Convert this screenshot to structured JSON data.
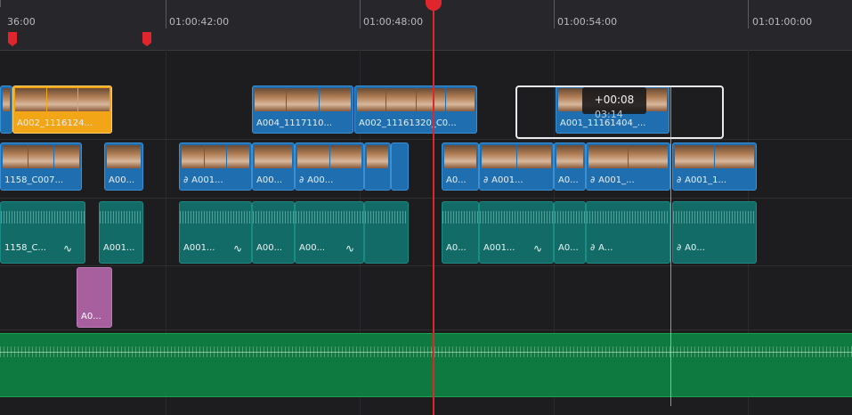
{
  "ruler": {
    "timecodes": [
      "36:00",
      "01:00:42:00",
      "01:00:48:00",
      "01:00:54:00",
      "01:01:00:00"
    ]
  },
  "tooltip": {
    "delta": "+00:08",
    "frames": "03:14"
  },
  "tracks": {
    "v2": [
      {
        "label": "A002_1116124..."
      },
      {
        "label": "A004_1117110..."
      },
      {
        "label": "A002_11161320_C0..."
      },
      {
        "label": "A001_11161404_..."
      }
    ],
    "v1": [
      {
        "label": "1158_C007..."
      },
      {
        "label": "A00..."
      },
      {
        "label": "A001..."
      },
      {
        "label": "A00..."
      },
      {
        "label": "A00..."
      },
      {
        "label": "A0..."
      },
      {
        "label": "A001..."
      },
      {
        "label": "A0..."
      },
      {
        "label": "A001_..."
      },
      {
        "label": "A001_1..."
      }
    ],
    "a1": [
      {
        "label": "1158_C..."
      },
      {
        "label": "A001..."
      },
      {
        "label": "A001..."
      },
      {
        "label": "A00..."
      },
      {
        "label": "A00..."
      },
      {
        "label": "A0..."
      },
      {
        "label": "A001..."
      },
      {
        "label": "A0..."
      },
      {
        "label": "A..."
      },
      {
        "label": "A0..."
      }
    ],
    "a2_pink": {
      "label": "A0..."
    }
  },
  "colors": {
    "playhead": "#e0262c",
    "video_clip": "#1f6fb0",
    "audio_clip": "#136b67",
    "selected_clip": "#f2a516",
    "music_track": "#0f7a3f",
    "pink_clip": "#a85f9d"
  }
}
